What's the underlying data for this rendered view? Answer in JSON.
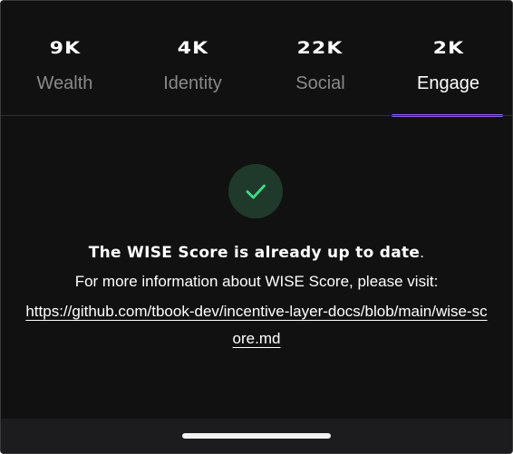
{
  "tabs": [
    {
      "score": "9K",
      "label": "Wealth",
      "active": false
    },
    {
      "score": "4K",
      "label": "Identity",
      "active": false
    },
    {
      "score": "22K",
      "label": "Social",
      "active": false
    },
    {
      "score": "2K",
      "label": "Engage",
      "active": true
    }
  ],
  "status": {
    "icon": "checkmark-icon",
    "headline": "The WISE Score is already up to date",
    "headline_suffix": ".",
    "info_text": "For more information about WISE Score, please visit:",
    "link_text": "https://github.com/tbook-dev/incentive-layer-docs/blob/main/wise-score.md"
  },
  "colors": {
    "background": "#111111",
    "active_tab_underline": "#8b5cf6",
    "check_badge_bg": "#1f3a2b",
    "check_icon": "#3ddc84",
    "inactive_label": "#8a8a8a"
  }
}
